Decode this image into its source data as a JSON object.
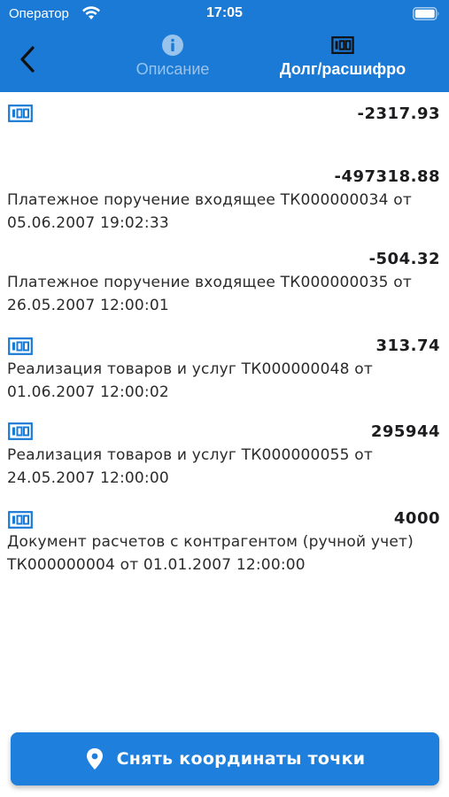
{
  "status_bar": {
    "carrier": "Оператор",
    "time": "17:05"
  },
  "nav": {
    "tabs": [
      {
        "label": "Описание",
        "icon": "info-icon",
        "active": false
      },
      {
        "label": "Долг/расшифро",
        "icon": "table-icon",
        "active": true
      }
    ]
  },
  "colors": {
    "header": "#1a7ad6",
    "button": "#1e7fdc",
    "icon": "#1a7ad6"
  },
  "entries": [
    {
      "icon": "table-icon",
      "amount": "-2317.93",
      "description": ""
    },
    {
      "icon": "",
      "amount": "-497318.88",
      "description": "Платежное поручение входящее ТК000000034 от 05.06.2007 19:02:33"
    },
    {
      "icon": "",
      "amount": "-504.32",
      "description": "Платежное поручение входящее ТК000000035 от 26.05.2007 12:00:01"
    },
    {
      "icon": "table-icon",
      "amount": "313.74",
      "description": "Реализация товаров и услуг ТК000000048 от 01.06.2007 12:00:02"
    },
    {
      "icon": "table-icon",
      "amount": "295944",
      "description": "Реализация товаров и услуг ТК000000055 от 24.05.2007 12:00:00"
    },
    {
      "icon": "table-icon",
      "amount": "4000",
      "description": "Документ расчетов с контрагентом (ручной учет) ТК000000004 от 01.01.2007 12:00:00"
    }
  ],
  "action": {
    "label": "Снять координаты точки",
    "icon": "map-pin-icon"
  }
}
